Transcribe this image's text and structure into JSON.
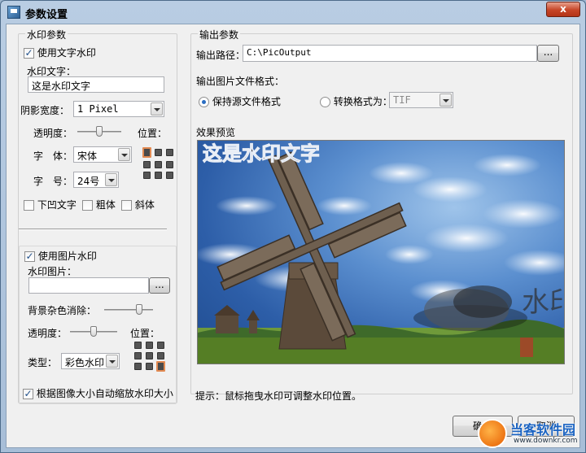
{
  "window": {
    "title": "参数设置",
    "close": "x"
  },
  "text_wm": {
    "group": "水印参数",
    "use_text": "使用文字水印",
    "text_label": "水印文字：",
    "text_value": "这是水印文字",
    "shadow_label": "阴影宽度：",
    "shadow_value": "1 Pixel",
    "opacity_label": "透明度：",
    "opacity_level": 0.5,
    "position_label": "位置：",
    "font_label": "字　体：",
    "font_value": "宋体",
    "size_label": "字　号：",
    "size_value": "24号",
    "emboss": "下凹文字",
    "bold": "粗体",
    "italic": "斜体"
  },
  "image_wm": {
    "use_image": "使用图片水印",
    "image_label": "水印图片：",
    "image_value": "",
    "browse": "...",
    "bg_remove_label": "背景杂色消除：",
    "bg_remove_level": 0.75,
    "opacity_label": "透明度：",
    "opacity_level": 0.5,
    "position_label": "位置：",
    "type_label": "类型：",
    "type_value": "彩色水印",
    "auto_scale": "根据图像大小自动缩放水印大小"
  },
  "output": {
    "group": "输出参数",
    "path_label": "输出路径：",
    "path_value": "C:\\PicOutput",
    "browse": "...",
    "format_label": "输出图片文件格式：",
    "keep_format": "保持源文件格式",
    "convert_format": "转换格式为：",
    "convert_value": "TIF"
  },
  "preview": {
    "label": "效果预览",
    "watermark_text": "这是水印文字",
    "seal_text": "水印"
  },
  "hint": "提示：鼠标拖曳水印可调整水印位置。",
  "buttons": {
    "ok": "确定",
    "cancel": "取消"
  },
  "site_badge": {
    "name": "当客软件园",
    "url": "www.downkr.com"
  }
}
